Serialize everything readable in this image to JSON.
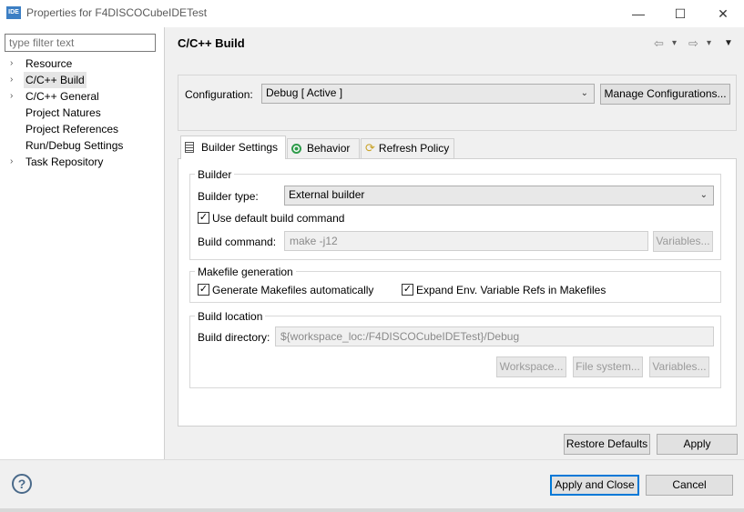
{
  "window": {
    "icon_text": "IDE",
    "title": "Properties for F4DISCOCubeIDETest",
    "minimize": "—",
    "maximize": "☐",
    "close": "✕"
  },
  "filter": {
    "placeholder": "type filter text"
  },
  "tree": [
    {
      "label": "Resource",
      "arrow": "›"
    },
    {
      "label": "C/C++ Build",
      "arrow": "›"
    },
    {
      "label": "C/C++ General",
      "arrow": "›"
    },
    {
      "label": "Project Natures",
      "arrow": ""
    },
    {
      "label": "Project References",
      "arrow": ""
    },
    {
      "label": "Run/Debug Settings",
      "arrow": ""
    },
    {
      "label": "Task Repository",
      "arrow": "›"
    }
  ],
  "page": {
    "title": "C/C++ Build",
    "nav_back": "⇦",
    "nav_forward": "⇨",
    "nav_dropdown": "▾",
    "menu": "▼"
  },
  "configuration": {
    "label": "Configuration:",
    "value": "Debug  [ Active ]",
    "manage_button": "Manage Configurations..."
  },
  "tabs": [
    {
      "label": "Builder Settings",
      "icon": "builder-settings-icon",
      "active": true
    },
    {
      "label": "Behavior",
      "icon": "behavior-icon",
      "active": false
    },
    {
      "label": "Refresh Policy",
      "icon": "refresh-policy-icon",
      "active": false
    }
  ],
  "builder": {
    "group_title": "Builder",
    "type_label": "Builder type:",
    "type_value": "External builder",
    "use_default_label": "Use default build command",
    "use_default_checked": true,
    "command_label": "Build command:",
    "command_value": "make -j12",
    "variables_button": "Variables..."
  },
  "makefile": {
    "group_title": "Makefile generation",
    "generate_label": "Generate Makefiles automatically",
    "expand_label": "Expand Env. Variable Refs in Makefiles"
  },
  "location": {
    "group_title": "Build location",
    "dir_label": "Build directory:",
    "dir_value": "${workspace_loc:/F4DISCOCubeIDETest}/Debug",
    "workspace_button": "Workspace...",
    "filesystem_button": "File system...",
    "variables_button": "Variables..."
  },
  "actions": {
    "restore_defaults": "Restore Defaults",
    "apply": "Apply",
    "apply_and_close": "Apply and Close",
    "cancel": "Cancel",
    "help": "?"
  },
  "colors": {
    "accent": "#0078d7",
    "behavior_icon": "#2e9b4a",
    "refresh_icon": "#c9a227"
  }
}
